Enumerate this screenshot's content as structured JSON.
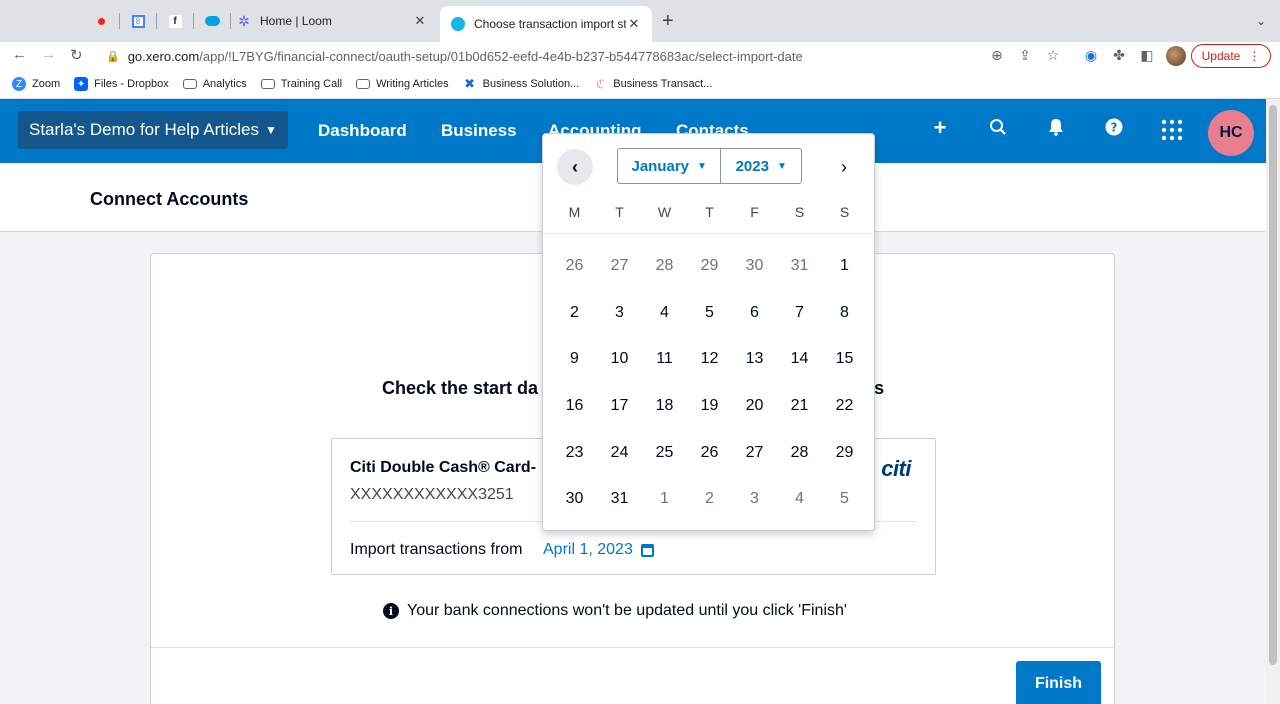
{
  "browser": {
    "tabs": [
      {
        "title": "Home | Loom",
        "icon": "loom-icon"
      },
      {
        "title": "Choose transaction import star",
        "icon": "xero-icon",
        "active": true
      }
    ],
    "url_host": "go.xero.com",
    "url_path": "/app/!L7BYG/financial-connect/oauth-setup/01b0d652-eefd-4e4b-b237-b544778683ac/select-import-date",
    "update_label": "Update",
    "bookmarks": [
      "Zoom",
      "Files - Dropbox",
      "Analytics",
      "Training Call",
      "Writing Articles",
      "Business Solution...",
      "Business Transact..."
    ]
  },
  "header": {
    "org_name": "Starla's Demo for Help Articles",
    "nav": [
      "Dashboard",
      "Business",
      "Accounting",
      "Contacts"
    ],
    "user_initials": "HC"
  },
  "page": {
    "title": "Connect Accounts",
    "check_title_prefix": "Check the start da",
    "check_title_suffix": "s",
    "account_name": "Citi Double Cash® Card-",
    "account_number": "XXXXXXXXXXXX3251",
    "bank_logo": "citi",
    "import_label": "Import transactions from",
    "import_date": "April 1, 2023",
    "info_text": "Your bank connections won't be updated until you click 'Finish'",
    "finish_label": "Finish"
  },
  "datepicker": {
    "month": "January",
    "year": "2023",
    "weekdays": [
      "M",
      "T",
      "W",
      "T",
      "F",
      "S",
      "S"
    ],
    "weeks": [
      [
        {
          "d": "26",
          "out": true
        },
        {
          "d": "27",
          "out": true
        },
        {
          "d": "28",
          "out": true
        },
        {
          "d": "29",
          "out": true
        },
        {
          "d": "30",
          "out": true
        },
        {
          "d": "31",
          "out": true
        },
        {
          "d": "1"
        }
      ],
      [
        {
          "d": "2"
        },
        {
          "d": "3"
        },
        {
          "d": "4"
        },
        {
          "d": "5"
        },
        {
          "d": "6"
        },
        {
          "d": "7"
        },
        {
          "d": "8"
        }
      ],
      [
        {
          "d": "9"
        },
        {
          "d": "10"
        },
        {
          "d": "11"
        },
        {
          "d": "12"
        },
        {
          "d": "13"
        },
        {
          "d": "14"
        },
        {
          "d": "15"
        }
      ],
      [
        {
          "d": "16"
        },
        {
          "d": "17"
        },
        {
          "d": "18"
        },
        {
          "d": "19"
        },
        {
          "d": "20"
        },
        {
          "d": "21"
        },
        {
          "d": "22"
        }
      ],
      [
        {
          "d": "23"
        },
        {
          "d": "24"
        },
        {
          "d": "25"
        },
        {
          "d": "26"
        },
        {
          "d": "27"
        },
        {
          "d": "28"
        },
        {
          "d": "29"
        }
      ],
      [
        {
          "d": "30"
        },
        {
          "d": "31"
        },
        {
          "d": "1",
          "out": true
        },
        {
          "d": "2",
          "out": true
        },
        {
          "d": "3",
          "out": true
        },
        {
          "d": "4",
          "out": true
        },
        {
          "d": "5",
          "out": true
        }
      ]
    ]
  },
  "colors": {
    "xero_blue": "#0078c8",
    "org_button": "#13578d",
    "avatar": "#e87e8f"
  }
}
